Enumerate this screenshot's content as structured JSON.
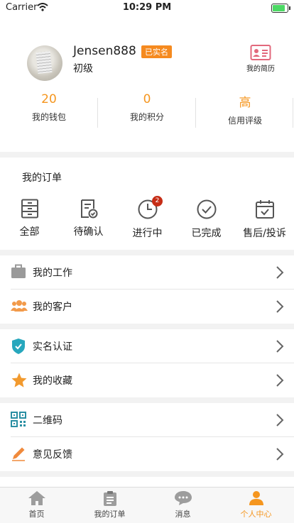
{
  "status": {
    "carrier": "Carrier",
    "time": "10:29 PM"
  },
  "profile": {
    "username": "Jensen888",
    "badge": "已实名",
    "level": "初级",
    "resume_label": "我的简历"
  },
  "stats": [
    {
      "value": "20",
      "label": "我的钱包"
    },
    {
      "value": "0",
      "label": "我的积分"
    },
    {
      "value": "高",
      "label": "信用评级"
    }
  ],
  "orders": {
    "title": "我的订单",
    "items": [
      {
        "label": "全部",
        "icon": "cabinet-icon"
      },
      {
        "label": "待确认",
        "icon": "document-check-icon"
      },
      {
        "label": "进行中",
        "icon": "clock-icon",
        "badge": "2"
      },
      {
        "label": "已完成",
        "icon": "check-circle-icon"
      },
      {
        "label": "售后/投诉",
        "icon": "calendar-check-icon"
      }
    ]
  },
  "menu": {
    "work": "我的工作",
    "customers": "我的客户",
    "verify": "实名认证",
    "favorites": "我的收藏",
    "qrcode": "二维码",
    "feedback": "意见反馈"
  },
  "tabs": [
    {
      "label": "首页",
      "icon": "home-icon"
    },
    {
      "label": "我的订单",
      "icon": "clipboard-icon"
    },
    {
      "label": "消息",
      "icon": "chat-bubble-icon"
    },
    {
      "label": "个人中心",
      "icon": "person-icon",
      "active": true
    }
  ],
  "colors": {
    "accent": "#f5961f",
    "badge_red": "#c62d16",
    "teal": "#27a7bd"
  }
}
